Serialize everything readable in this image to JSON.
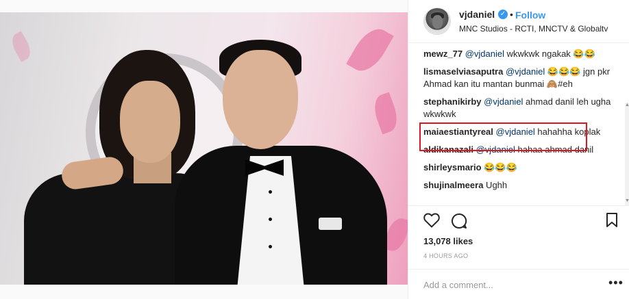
{
  "post": {
    "username": "vjdaniel",
    "verified_icon": "verified-badge-icon",
    "follow_label": "Follow",
    "separator": "•",
    "location": "MNC Studios - RCTI, MNCTV & Globaltv"
  },
  "comments": [
    {
      "user": "mewz_77",
      "mention": "@vjdaniel",
      "text": " wkwkwk ngakak 😂😂"
    },
    {
      "user": "lismaselviasaputra",
      "mention": "@vjdaniel",
      "text": " 😂😂😂 jgn pkr Ahmad kan itu mantan bunmai 🙈#eh"
    },
    {
      "user": "stephanikirby",
      "mention": "@vjdaniel",
      "text": " ahmad danil leh ugha wkwkwk"
    },
    {
      "user": "maiaestiantyreal",
      "mention": "@vjdaniel",
      "text": " hahahha koplak"
    },
    {
      "user": "aldikanazali",
      "mention": "@vjdaniel",
      "text": " hahaa ahmad danil"
    },
    {
      "user": "shirleysmario",
      "mention": "",
      "text": " 😂😂😂"
    },
    {
      "user": "shujinalmeera",
      "mention": "",
      "text": " Ughh"
    }
  ],
  "actions": {
    "likes": "13,078 likes",
    "time": "4 HOURS AGO"
  },
  "add_comment": {
    "placeholder": "Add a comment...",
    "more": "•••"
  },
  "colors": {
    "accent": "#3897f0",
    "highlight": "#e0161e",
    "mention": "#003569"
  }
}
